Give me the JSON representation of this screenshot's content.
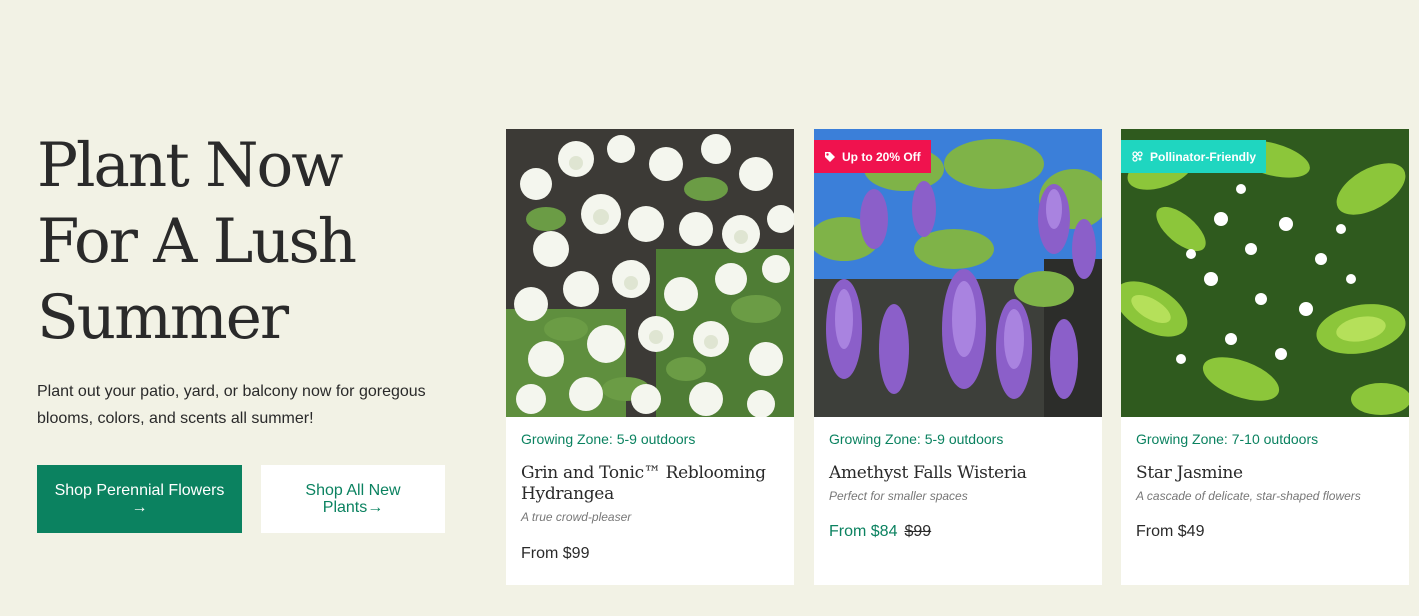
{
  "hero": {
    "title_lines": [
      "Plant Now",
      "For A Lush",
      "Summer"
    ],
    "subtitle": "Plant out your patio, yard, or balcony now for goregous blooms, colors, and scents all summer!",
    "primary_button": {
      "label": "Shop Perennial Flowers",
      "arrow": "→"
    },
    "secondary_button": {
      "label": "Shop All New Plants",
      "arrow": "→"
    }
  },
  "products": [
    {
      "zone": "Growing Zone: 5-9 outdoors",
      "name": "Grin and Tonic™ Reblooming Hydrangea",
      "tagline": "A true crowd-pleaser",
      "price": "From $99",
      "image": "white-hydrangea-photo"
    },
    {
      "badge": {
        "label": "Up to 20% Off",
        "icon": "tag-icon",
        "color": "#f0124e"
      },
      "zone": "Growing Zone: 5-9 outdoors",
      "name": "Amethyst Falls Wisteria",
      "tagline": "Perfect for smaller spaces",
      "price": "From $84",
      "was_price": "$99",
      "image": "purple-wisteria-photo"
    },
    {
      "badge": {
        "label": "Pollinator-Friendly",
        "icon": "flower-icon",
        "color": "#1fd6c0"
      },
      "zone": "Growing Zone: 7-10 outdoors",
      "name": "Star Jasmine",
      "tagline": "A cascade of delicate, star-shaped flowers",
      "price": "From $49",
      "image": "star-jasmine-photo"
    }
  ],
  "colors": {
    "background": "#f2f2e5",
    "brand_green": "#0b8260",
    "sale_red": "#f0124e",
    "pollinator_teal": "#1fd6c0"
  }
}
